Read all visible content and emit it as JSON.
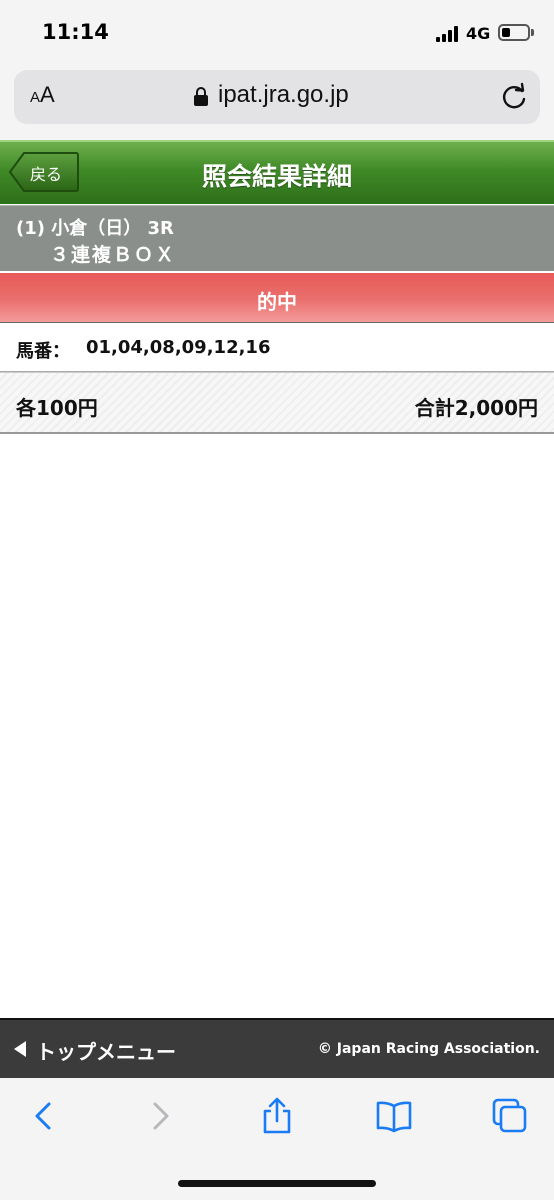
{
  "status_bar": {
    "time": "11:14",
    "network": "4G",
    "battery_level": 0.25
  },
  "browser": {
    "text_size_label": "AA",
    "url": "ipat.jra.go.jp",
    "icons": [
      "lock-icon",
      "reload-icon",
      "back-arrow-icon",
      "forward-arrow-icon",
      "share-icon",
      "bookmarks-icon",
      "tabs-icon"
    ]
  },
  "header": {
    "back_label": "戻る",
    "title": "照会結果詳細"
  },
  "race": {
    "line1": "(1) 小倉（日） 3R",
    "line2": "３連複ＢＯＸ"
  },
  "result": {
    "label": "的中"
  },
  "horses": {
    "label": "馬番：",
    "value": "01,04,08,09,12,16"
  },
  "amounts": {
    "each": "各100円",
    "total": "合計2,000円"
  },
  "footer": {
    "top_menu_label": "トップメニュー",
    "copyright": "© Japan Racing Association."
  },
  "colors": {
    "header_green": "#3f8a27",
    "race_band_grey": "#8a8f8b",
    "hit_red": "#e85a58",
    "footer_dark": "#3b3b3b",
    "ios_blue": "#1a7cf5"
  }
}
